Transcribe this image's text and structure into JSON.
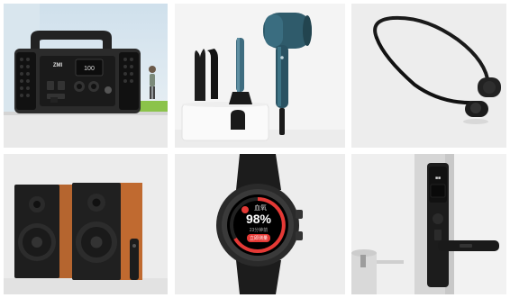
{
  "grid": {
    "products": [
      {
        "name": "portable-power-station",
        "brand_text": "ZMI"
      },
      {
        "name": "hair-styling-set"
      },
      {
        "name": "bone-conduction-headphones"
      },
      {
        "name": "bookshelf-speakers"
      },
      {
        "name": "smartwatch",
        "screen": {
          "title": "血氧",
          "value": "98%",
          "subtext": "23分钟前",
          "button": "立即测量"
        }
      },
      {
        "name": "smart-door-lock"
      }
    ]
  },
  "colors": {
    "tile_bg": "#ededed",
    "accent_red": "#e53935",
    "speaker_wood": "#b5652f",
    "dryer_blue": "#2f5b6b"
  }
}
